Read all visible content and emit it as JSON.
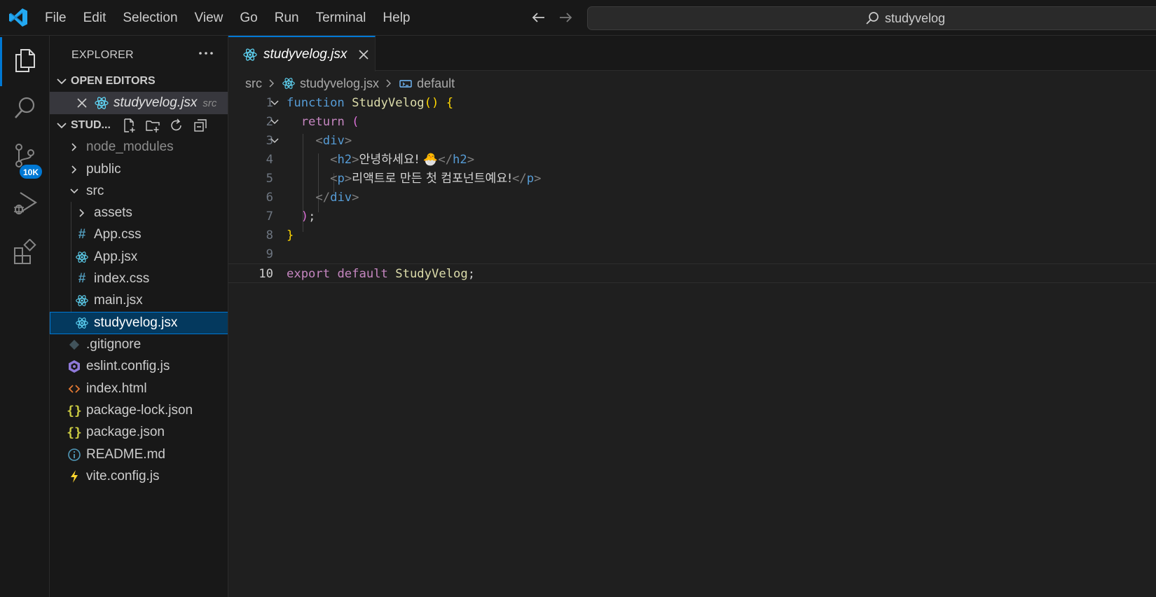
{
  "menu": [
    "File",
    "Edit",
    "Selection",
    "View",
    "Go",
    "Run",
    "Terminal",
    "Help"
  ],
  "command_center": {
    "label": "studyvelog"
  },
  "activity_bar": {
    "scm_badge": "10K"
  },
  "sidebar": {
    "title": "EXPLORER",
    "open_editors": {
      "header": "OPEN EDITORS",
      "items": [
        {
          "name": "studyvelog.jsx",
          "folder": "src"
        }
      ]
    },
    "project": {
      "header": "STUD..."
    },
    "tree": [
      {
        "label": "node_modules",
        "kind": "folder",
        "icon": "chevron-right-icon"
      },
      {
        "label": "public",
        "kind": "folder",
        "icon": "chevron-right-icon"
      },
      {
        "label": "src",
        "kind": "folder-open",
        "icon": "chevron-down-icon"
      },
      {
        "label": "assets",
        "kind": "folder",
        "icon": "chevron-right-icon"
      },
      {
        "label": "App.css",
        "kind": "file",
        "icon": "css-hash-icon"
      },
      {
        "label": "App.jsx",
        "kind": "file",
        "icon": "react-icon"
      },
      {
        "label": "index.css",
        "kind": "file",
        "icon": "css-hash-icon"
      },
      {
        "label": "main.jsx",
        "kind": "file",
        "icon": "react-icon"
      },
      {
        "label": "studyvelog.jsx",
        "kind": "file",
        "icon": "react-icon",
        "selected": true
      },
      {
        "label": ".gitignore",
        "kind": "file",
        "icon": "git-icon"
      },
      {
        "label": "eslint.config.js",
        "kind": "file",
        "icon": "eslint-icon"
      },
      {
        "label": "index.html",
        "kind": "file",
        "icon": "html-icon"
      },
      {
        "label": "package-lock.json",
        "kind": "file",
        "icon": "json-icon"
      },
      {
        "label": "package.json",
        "kind": "file",
        "icon": "json-icon"
      },
      {
        "label": "README.md",
        "kind": "file",
        "icon": "info-icon"
      },
      {
        "label": "vite.config.js",
        "kind": "file",
        "icon": "vite-icon"
      }
    ]
  },
  "editor": {
    "tab": {
      "label": "studyvelog.jsx"
    },
    "breadcrumb": {
      "folder": "src",
      "file": "studyvelog.jsx",
      "symbol": "default"
    },
    "line_numbers": [
      "1",
      "2",
      "3",
      "4",
      "5",
      "6",
      "7",
      "8",
      "9",
      "10"
    ],
    "code": {
      "l1_kw": "function",
      "l1_fn": "StudyVelog",
      "l1_paren": "()",
      "l1_brace": "{",
      "l2_kw": "return",
      "l2_paren": "(",
      "l3_open": "<",
      "l3_tag": "div",
      "l3_close": ">",
      "l4_tag_open": "h2",
      "l4_text": "안녕하세요! 🐣",
      "l4_tag_close": "h2",
      "l5_tag_open": "p",
      "l5_text": "리액트로 만든 첫 컴포넌트예요!",
      "l5_tag_close": "p",
      "l6_tag": "div",
      "l7_paren": ")",
      "l7_semi": ";",
      "l8_brace": "}",
      "l10_kw1": "export",
      "l10_kw2": "default",
      "l10_name": "StudyVelog",
      "l10_semi": ";"
    }
  },
  "colors": {
    "accent": "#0078d4",
    "selection": "#04395e",
    "background": "#1f1f1f",
    "chrome": "#181818"
  }
}
